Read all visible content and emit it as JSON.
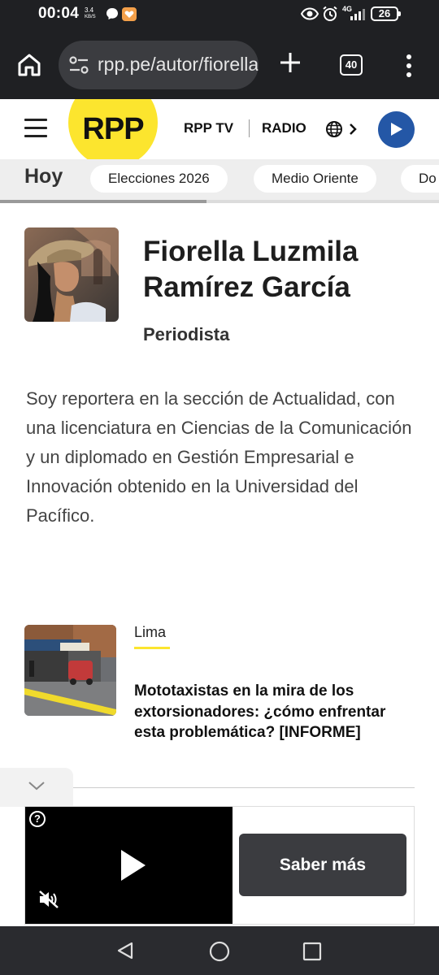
{
  "status_bar": {
    "time": "00:04",
    "speed_top": "3.4",
    "speed_bottom": "KB/S",
    "network": "4G",
    "battery": "26"
  },
  "browser": {
    "url": "rpp.pe/autor/fiorella",
    "tab_count": "40"
  },
  "site_header": {
    "logo": "RPP",
    "nav": [
      "RPP TV",
      "RADIO"
    ],
    "icons": [
      "globe-icon",
      "chevron-right-icon",
      "play-icon"
    ],
    "accent_color": "#fce52e",
    "play_color": "#2457a6"
  },
  "category_strip": {
    "active": "Hoy",
    "pills": [
      "Elecciones 2026",
      "Medio Oriente",
      "Do"
    ]
  },
  "author": {
    "name": "Fiorella Luzmila Ramírez García",
    "role": "Periodista",
    "bio": "Soy reportera en la sección de Actualidad, con una licenciatura en Ciencias de la Comunicación y un diplomado en Gestión Empresarial e Innovación obtenido en la Universidad del Pacífico."
  },
  "articles": [
    {
      "category": "Lima",
      "title": "Mototaxistas en la mira de los extorsionadores: ¿cómo enfrentar esta problemática? [INFORME]"
    }
  ],
  "ad": {
    "help": "?",
    "cta": "Saber más"
  }
}
